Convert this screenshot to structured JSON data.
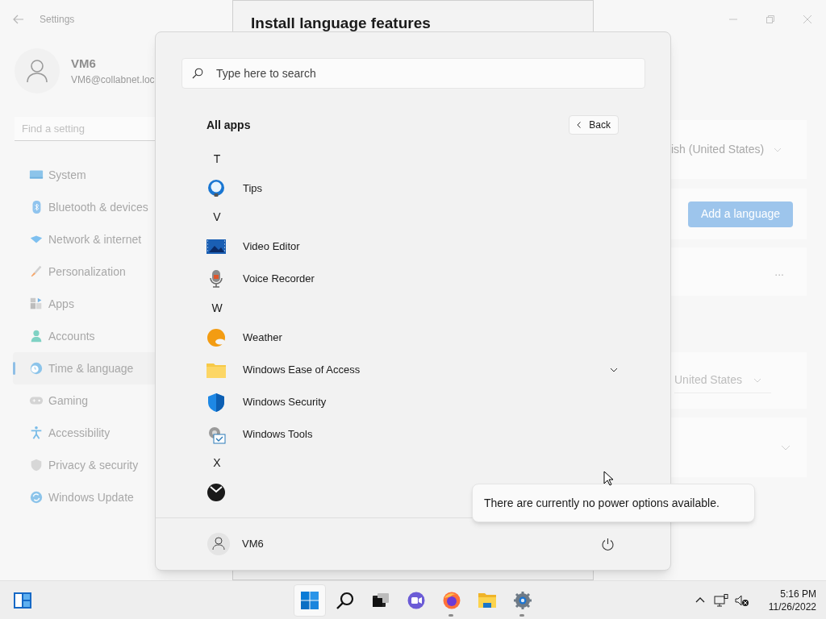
{
  "settings": {
    "title": "Settings",
    "user": {
      "name": "VM6",
      "email": "VM6@collabnet.loc"
    },
    "search": {
      "placeholder": "Find a setting"
    },
    "nav": [
      {
        "label": "System",
        "selected": false
      },
      {
        "label": "Bluetooth & devices",
        "selected": false
      },
      {
        "label": "Network & internet",
        "selected": false
      },
      {
        "label": "Personalization",
        "selected": false
      },
      {
        "label": "Apps",
        "selected": false
      },
      {
        "label": "Accounts",
        "selected": false
      },
      {
        "label": "Time & language",
        "selected": true
      },
      {
        "label": "Gaming",
        "selected": false
      },
      {
        "label": "Accessibility",
        "selected": false
      },
      {
        "label": "Privacy & security",
        "selected": false
      },
      {
        "label": "Windows Update",
        "selected": false
      }
    ],
    "content": {
      "language_dropdown": "ish (United States)",
      "add_language_button": "Add a language",
      "more_button": "...",
      "region_dropdown": "United States"
    }
  },
  "dialog": {
    "title": "Install language features"
  },
  "start_menu": {
    "search": {
      "placeholder": "Type here to search"
    },
    "heading": "All apps",
    "back_button": "Back",
    "apps": [
      {
        "kind": "letter",
        "label": "T"
      },
      {
        "kind": "app",
        "label": "Tips"
      },
      {
        "kind": "letter",
        "label": "V"
      },
      {
        "kind": "app",
        "label": "Video Editor"
      },
      {
        "kind": "app",
        "label": "Voice Recorder"
      },
      {
        "kind": "letter",
        "label": "W"
      },
      {
        "kind": "app",
        "label": "Weather"
      },
      {
        "kind": "folder",
        "label": "Windows Ease of Access",
        "expanded": false
      },
      {
        "kind": "app",
        "label": "Windows Security"
      },
      {
        "kind": "app",
        "label": "Windows Tools"
      },
      {
        "kind": "letter",
        "label": "X"
      },
      {
        "kind": "app"
      }
    ],
    "user": "VM6"
  },
  "tooltip": "There are currently no power options available.",
  "taskbar": {
    "apps": [
      {
        "selected": true,
        "running": false
      },
      {
        "selected": false,
        "running": false
      },
      {
        "selected": false,
        "running": false
      },
      {
        "selected": false,
        "running": false
      },
      {
        "selected": false,
        "running": true
      },
      {
        "selected": false,
        "running": false
      },
      {
        "selected": false,
        "running": true
      }
    ],
    "time": "5:16 PM",
    "date": "11/26/2022"
  }
}
